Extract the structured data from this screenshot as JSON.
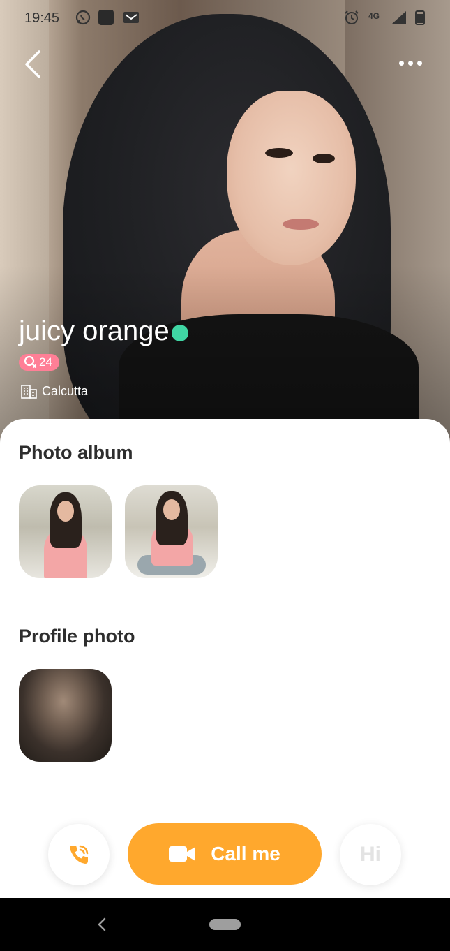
{
  "status_bar": {
    "time": "19:45",
    "network": "4G",
    "icons": [
      "whatsapp-icon",
      "app-icon",
      "gmail-icon",
      "alarm-icon",
      "signal-icon",
      "battery-icon"
    ]
  },
  "header": {
    "back_icon": "chevron-left-icon",
    "more_icon": "more-dots-icon"
  },
  "profile": {
    "name": "juicy orange",
    "online": true,
    "age": "24",
    "city": "Calcutta"
  },
  "sections": {
    "photo_album_title": "Photo album",
    "profile_photo_title": "Profile photo"
  },
  "actions": {
    "call_label": "Call me",
    "hi_label": "Hi"
  },
  "colors": {
    "accent": "#ffa82d",
    "online": "#40d6a4",
    "badge": "#ff7f96"
  }
}
